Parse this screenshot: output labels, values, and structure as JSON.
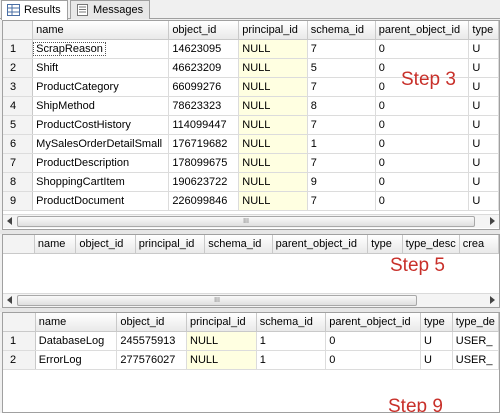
{
  "tabs": [
    {
      "label": "Results",
      "icon": "grid-icon",
      "active": true
    },
    {
      "label": "Messages",
      "icon": "messages-icon",
      "active": false
    }
  ],
  "grid1": {
    "columns": [
      "",
      "name",
      "object_id",
      "principal_id",
      "schema_id",
      "parent_object_id",
      "type"
    ],
    "rows": [
      [
        "1",
        "ScrapReason",
        "14623095",
        "NULL",
        "7",
        "0",
        "U"
      ],
      [
        "2",
        "Shift",
        "46623209",
        "NULL",
        "5",
        "0",
        "U"
      ],
      [
        "3",
        "ProductCategory",
        "66099276",
        "NULL",
        "7",
        "0",
        "U"
      ],
      [
        "4",
        "ShipMethod",
        "78623323",
        "NULL",
        "8",
        "0",
        "U"
      ],
      [
        "5",
        "ProductCostHistory",
        "114099447",
        "NULL",
        "7",
        "0",
        "U"
      ],
      [
        "6",
        "MySalesOrderDetailSmall",
        "176719682",
        "NULL",
        "1",
        "0",
        "U"
      ],
      [
        "7",
        "ProductDescription",
        "178099675",
        "NULL",
        "7",
        "0",
        "U"
      ],
      [
        "8",
        "ShoppingCartItem",
        "190623722",
        "NULL",
        "9",
        "0",
        "U"
      ],
      [
        "9",
        "ProductDocument",
        "226099846",
        "NULL",
        "7",
        "0",
        "U"
      ]
    ],
    "scroll_label": "III",
    "annotation": "Step 3"
  },
  "grid2": {
    "columns": [
      "",
      "name",
      "object_id",
      "principal_id",
      "schema_id",
      "parent_object_id",
      "type",
      "type_desc",
      "crea"
    ],
    "rows": [],
    "scroll_label": "III",
    "annotation": "Step 5"
  },
  "grid3": {
    "columns": [
      "",
      "name",
      "object_id",
      "principal_id",
      "schema_id",
      "parent_object_id",
      "type",
      "type_de"
    ],
    "rows": [
      [
        "1",
        "DatabaseLog",
        "245575913",
        "NULL",
        "1",
        "0",
        "U",
        "USER_"
      ],
      [
        "2",
        "ErrorLog",
        "277576027",
        "NULL",
        "1",
        "0",
        "U",
        "USER_"
      ]
    ],
    "scroll_label": "III",
    "annotation": "Step 9"
  },
  "colors": {
    "null_cell_bg": "#ffffe1",
    "annotation": "#c8302a"
  }
}
